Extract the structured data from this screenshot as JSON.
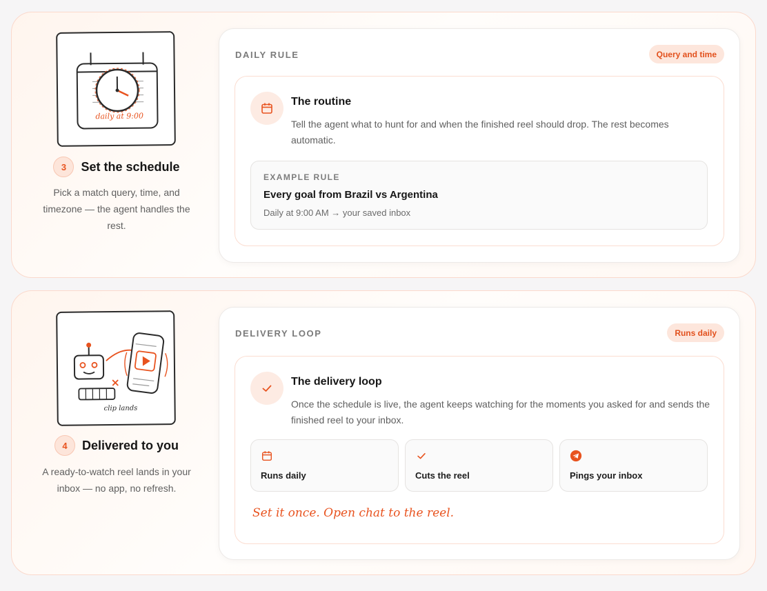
{
  "steps": [
    {
      "number": "3",
      "title": "Set the schedule",
      "description": "Pick a match query, time, and timezone — the agent handles the rest.",
      "illustration_caption": "daily at 9:00",
      "panel": {
        "label": "DAILY RULE",
        "pill": "Query and time",
        "icon": "calendar-icon",
        "title": "The routine",
        "description": "Tell the agent what to hunt for and when the finished reel should drop. The rest becomes automatic.",
        "example": {
          "label": "EXAMPLE RULE",
          "title": "Every goal from Brazil vs Argentina",
          "subtitle": "Daily at 9:00 AM → your saved inbox"
        }
      }
    },
    {
      "number": "4",
      "title": "Delivered to you",
      "description": "A ready-to-watch reel lands in your inbox — no app, no refresh.",
      "illustration_caption": "clip lands",
      "panel": {
        "label": "DELIVERY LOOP",
        "pill": "Runs daily",
        "icon": "check-icon",
        "title": "The delivery loop",
        "description": "Once the schedule is live, the agent keeps watching for the moments you asked for and sends the finished reel to your inbox.",
        "chips": [
          {
            "icon": "calendar-icon",
            "label": "Runs daily"
          },
          {
            "icon": "check-icon",
            "label": "Cuts the reel"
          },
          {
            "icon": "telegram-icon",
            "label": "Pings your inbox"
          }
        ],
        "tagline": "Set it once. Open chat to the reel."
      }
    }
  ],
  "colors": {
    "accent": "#e8531f",
    "accent_soft": "#fde6dc",
    "text": "#161616",
    "muted": "#5f5f5f"
  }
}
